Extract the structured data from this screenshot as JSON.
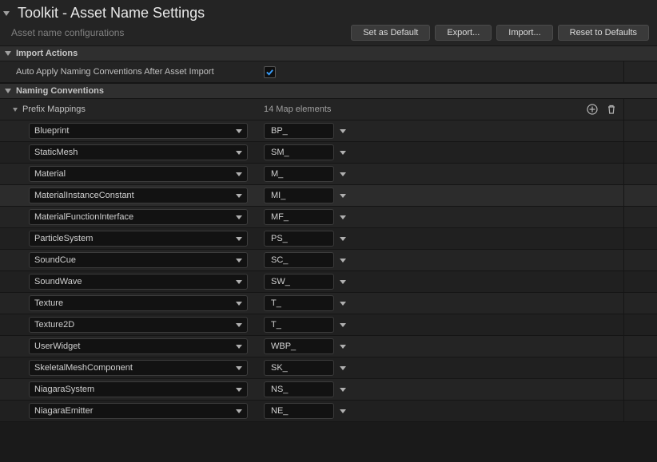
{
  "header": {
    "title": "Toolkit - Asset Name Settings",
    "subtitle": "Asset name configurations",
    "buttons": {
      "set_default": "Set as Default",
      "export": "Export...",
      "import": "Import...",
      "reset": "Reset to Defaults"
    }
  },
  "sections": {
    "import_actions": "Import Actions",
    "naming_conventions": "Naming Conventions"
  },
  "import_actions": {
    "auto_apply_label": "Auto Apply Naming Conventions After Asset Import",
    "auto_apply_checked": true
  },
  "prefix_mappings": {
    "label": "Prefix Mappings",
    "count_label": "14 Map elements",
    "rows": [
      {
        "key": "Blueprint",
        "val": "BP_"
      },
      {
        "key": "StaticMesh",
        "val": "SM_"
      },
      {
        "key": "Material",
        "val": "M_"
      },
      {
        "key": "MaterialInstanceConstant",
        "val": "MI_",
        "selected": true
      },
      {
        "key": "MaterialFunctionInterface",
        "val": "MF_"
      },
      {
        "key": "ParticleSystem",
        "val": "PS_"
      },
      {
        "key": "SoundCue",
        "val": "SC_"
      },
      {
        "key": "SoundWave",
        "val": "SW_"
      },
      {
        "key": "Texture",
        "val": "T_"
      },
      {
        "key": "Texture2D",
        "val": "T_"
      },
      {
        "key": "UserWidget",
        "val": "WBP_"
      },
      {
        "key": "SkeletalMeshComponent",
        "val": "SK_"
      },
      {
        "key": "NiagaraSystem",
        "val": "NS_"
      },
      {
        "key": "NiagaraEmitter",
        "val": "NE_"
      }
    ]
  }
}
